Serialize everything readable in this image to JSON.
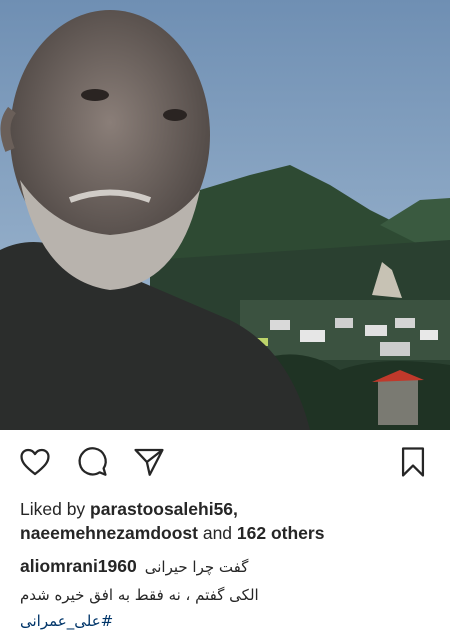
{
  "post": {
    "photo_icon": "selfie-photo",
    "colors": {
      "sky": "#6f8fb3",
      "mountain": "#2e4a33",
      "hashtag": "#003569",
      "text": "#262626"
    }
  },
  "actions": {
    "like_icon": "heart-icon",
    "comment_icon": "comment-icon",
    "share_icon": "share-icon",
    "save_icon": "bookmark-icon"
  },
  "likes": {
    "prefix": "Liked by ",
    "user1": "parastoosalehi56,",
    "user2": "naeemehnezamdoost",
    "connector": " and ",
    "others": "162 others"
  },
  "caption": {
    "username": "aliomrani1960",
    "line1": "گفت چرا حیرانی",
    "line2": "الکی گفتم ، نه فقط به افق خیره شدم",
    "hashtag": "#علی_عمرانی"
  }
}
